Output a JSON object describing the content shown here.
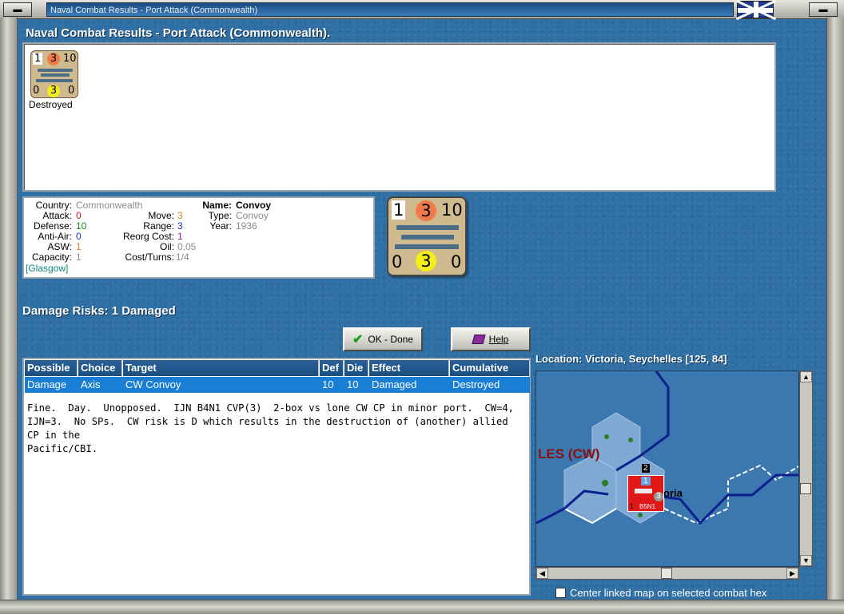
{
  "window": {
    "title": "Naval Combat Results - Port Attack (Commonwealth)",
    "nation_flag": "uk-flag-icon"
  },
  "heading": "Naval Combat Results - Port Attack (Commonwealth).",
  "results": {
    "units": [
      {
        "top_left": "1",
        "top_mid": "3",
        "top_right": "10",
        "bot_left": "0",
        "bot_mid": "3",
        "bot_right": "0",
        "status": "Destroyed"
      }
    ]
  },
  "unit_info": {
    "country_label": "Country:",
    "country": "Commonwealth",
    "attack_label": "Attack:",
    "attack": "0",
    "defense_label": "Defense:",
    "defense": "10",
    "antiair_label": "Anti-Air:",
    "antiair": "0",
    "asw_label": "ASW:",
    "asw": "1",
    "capacity_label": "Capacity:",
    "capacity": "1",
    "home_port": "[Glasgow]",
    "move_label": "Move:",
    "move": "3",
    "range_label": "Range:",
    "range": "3",
    "reorg_label": "Reorg Cost:",
    "reorg": "1",
    "oil_label": "Oil:",
    "oil": "0.05",
    "cost_label": "Cost/Turns:",
    "cost": "1/4",
    "name_label": "Name:",
    "name": "Convoy",
    "type_label": "Type:",
    "type": "Convoy",
    "year_label": "Year:",
    "year": "1936"
  },
  "big_counter": {
    "top_left": "1",
    "top_mid": "3",
    "top_right": "10",
    "bot_left": "0",
    "bot_mid": "3",
    "bot_right": "0"
  },
  "damage_risks": "Damage Risks:  1 Damaged",
  "buttons": {
    "ok": "OK - Done",
    "help": "Help"
  },
  "table": {
    "headers": [
      "Possible",
      "Choice",
      "Target",
      "Def",
      "Die",
      "Effect",
      "Cumulative"
    ],
    "rows": [
      [
        "Damage",
        "Axis",
        "CW Convoy",
        "10",
        "10",
        "Damaged",
        "Destroyed"
      ]
    ]
  },
  "notes": "Fine.  Day.  Unopposed.  IJN B4N1 CVP(3)  2-box vs lone CW CP in minor port.  CW=4,\nIJN=3.  No SPs.  CW risk is D which results in the destruction of (another) allied CP in the\nPacific/CBI.",
  "location": "Location:  Victoria, Seychelles [125, 84]",
  "map": {
    "region_label": "LES (CW)",
    "city_label": "oria",
    "stack_count": "2",
    "unit_top": "1",
    "unit_bot_left": "1",
    "unit_strength": "3",
    "unit_name": "B5N1"
  },
  "center_option": "Center linked map on selected combat hex"
}
